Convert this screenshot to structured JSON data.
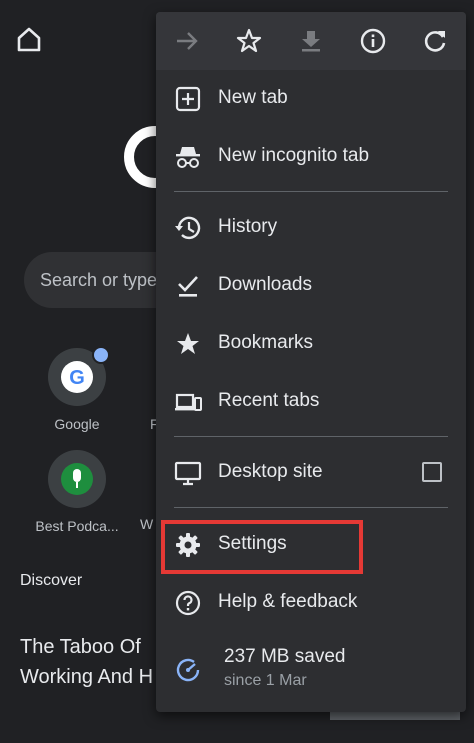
{
  "background_page": {
    "search_placeholder": "Search or type",
    "shortcuts": [
      {
        "label": "Google"
      },
      {
        "label": "Best Podca..."
      },
      {
        "label": "F"
      },
      {
        "label": "W"
      }
    ],
    "discover_label": "Discover",
    "article_title_line1": "The Taboo Of",
    "article_title_line2": "Working And H"
  },
  "menu": {
    "toolbar": {
      "forward": "forward-icon",
      "bookmark": "star-icon",
      "download": "download-icon",
      "info": "info-icon",
      "refresh": "refresh-icon"
    },
    "items": [
      {
        "label": "New tab",
        "icon": "new-tab-icon"
      },
      {
        "label": "New incognito tab",
        "icon": "incognito-icon"
      },
      {
        "label": "History",
        "icon": "history-icon"
      },
      {
        "label": "Downloads",
        "icon": "downloads-icon"
      },
      {
        "label": "Bookmarks",
        "icon": "bookmarks-icon"
      },
      {
        "label": "Recent tabs",
        "icon": "recent-tabs-icon"
      },
      {
        "label": "Desktop site",
        "icon": "desktop-icon",
        "checked": false
      },
      {
        "label": "Settings",
        "icon": "gear-icon",
        "highlighted": true
      },
      {
        "label": "Help & feedback",
        "icon": "help-icon"
      }
    ],
    "data_saver": {
      "amount": "237 MB saved",
      "since": "since 1 Mar"
    }
  },
  "colors": {
    "background": "#202124",
    "menu_bg": "#2d2e31",
    "highlight": "#e53935",
    "accent": "#8ab4f8"
  }
}
